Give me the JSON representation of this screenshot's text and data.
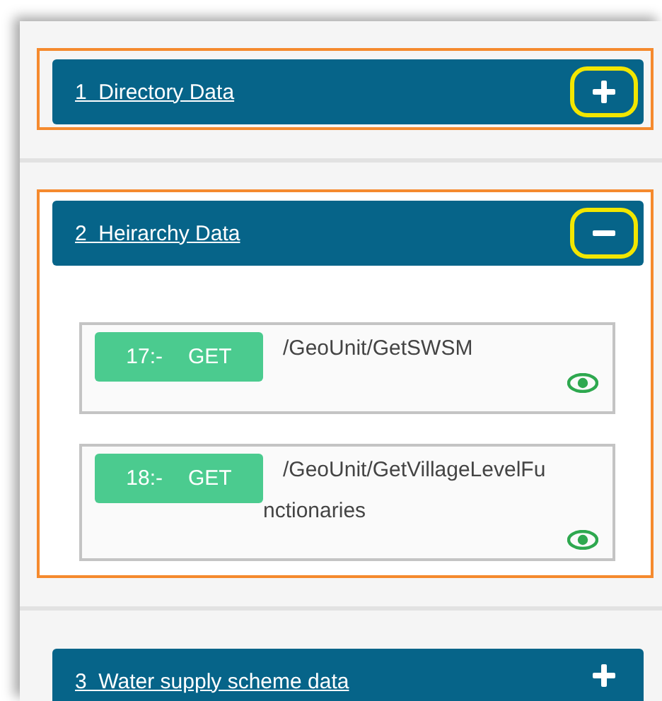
{
  "sections": [
    {
      "title": "1  Directory Data",
      "expanded": false,
      "highlighted": true,
      "toggle_highlighted": true
    },
    {
      "title": "2  Heirarchy Data",
      "expanded": true,
      "highlighted": true,
      "toggle_highlighted": true,
      "endpoints": [
        {
          "number": "17:-",
          "method": "GET",
          "path_lines": [
            "/GeoUnit/GetSWSM"
          ]
        },
        {
          "number": "18:-",
          "method": "GET",
          "path_lines": [
            "/GeoUnit/GetVillageLevelFu",
            "nctionaries"
          ]
        }
      ]
    },
    {
      "title": "3  Water supply scheme data",
      "expanded": false,
      "highlighted": false,
      "toggle_highlighted": false
    }
  ]
}
